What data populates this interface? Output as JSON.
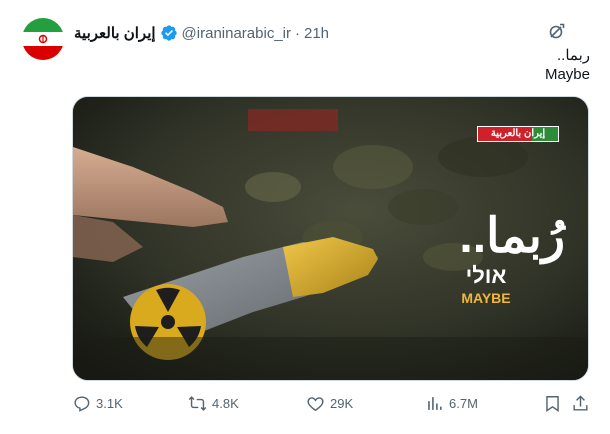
{
  "author": {
    "display_name": "إيران بالعربية",
    "handle": "@iraninarabic_ir",
    "separator": "·",
    "time": "21h"
  },
  "tweet": {
    "line1": "ربما..",
    "line2": "Maybe"
  },
  "media": {
    "logo_text": "إيران بالعربية",
    "headline_ar": "رُبما..",
    "headline_he": "אולי",
    "headline_en": "MAYBE"
  },
  "actions": {
    "replies": "3.1K",
    "reposts": "4.8K",
    "likes": "29K",
    "views": "6.7M"
  },
  "colors": {
    "verified": "#1d9bf0",
    "secondary_text": "#536471",
    "logo_red": "#d0202a",
    "logo_green": "#2e8b3a"
  },
  "icons": [
    "more-icon",
    "verified-badge-icon",
    "reply-icon",
    "repost-icon",
    "like-icon",
    "views-icon",
    "bookmark-icon",
    "share-icon"
  ]
}
